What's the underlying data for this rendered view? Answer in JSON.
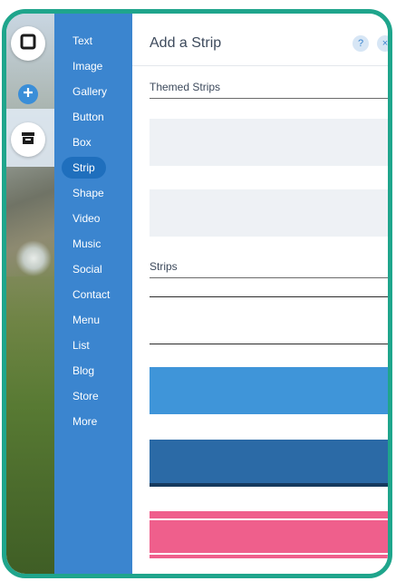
{
  "menu": {
    "items": [
      {
        "label": "Text"
      },
      {
        "label": "Image"
      },
      {
        "label": "Gallery"
      },
      {
        "label": "Button"
      },
      {
        "label": "Box"
      },
      {
        "label": "Strip",
        "active": true
      },
      {
        "label": "Shape"
      },
      {
        "label": "Video"
      },
      {
        "label": "Music"
      },
      {
        "label": "Social"
      },
      {
        "label": "Contact"
      },
      {
        "label": "Menu"
      },
      {
        "label": "List"
      },
      {
        "label": "Blog"
      },
      {
        "label": "Store"
      },
      {
        "label": "More"
      }
    ]
  },
  "panel": {
    "title": "Add a Strip",
    "help_label": "?",
    "close_label": "×",
    "themed_section": "Themed Strips",
    "strips_section": "Strips"
  },
  "colors": {
    "frame": "#1fa58c",
    "menu": "#3b85cf",
    "menu_active": "#1f6fbd",
    "blue_strip": "#3f95d9",
    "navy_strip": "#2b6aa6",
    "pink_strip": "#ef5f8c"
  },
  "icons": {
    "rail": [
      "square-outline-icon",
      "plus-icon",
      "store-icon"
    ]
  }
}
